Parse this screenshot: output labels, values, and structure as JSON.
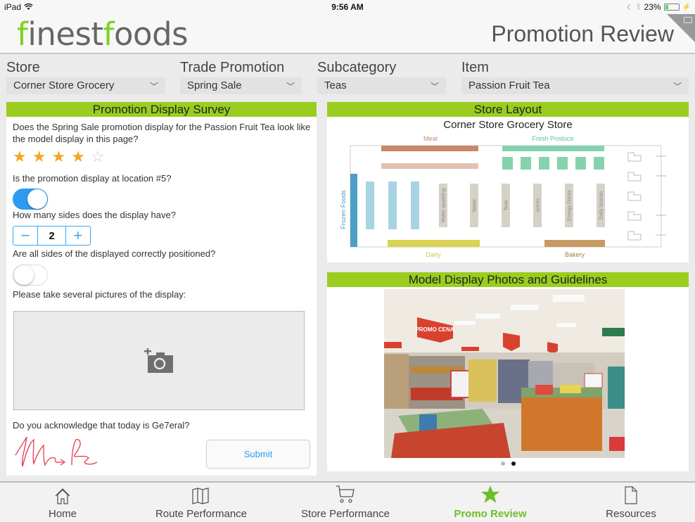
{
  "status_bar": {
    "device": "iPad",
    "time": "9:56 AM",
    "battery_percent": "23%",
    "battery_level": 0.23
  },
  "header": {
    "logo_part1": "finest",
    "logo_part2": "foods",
    "title": "Promotion Review"
  },
  "filters": [
    {
      "label": "Store",
      "value": "Corner Store Grocery"
    },
    {
      "label": "Trade Promotion",
      "value": "Spring Sale"
    },
    {
      "label": "Subcategory",
      "value": "Teas"
    },
    {
      "label": "Item",
      "value": "Passion Fruit Tea"
    }
  ],
  "survey": {
    "title": "Promotion Display Survey",
    "q1": "Does the Spring Sale promotion display for the Passion Fruit Tea look like the model display in this page?",
    "rating": 4,
    "rating_max": 5,
    "q2": "Is the promotion display at location #5?",
    "q2_answer": true,
    "q3": "How many sides does the display have?",
    "q3_value": "2",
    "q4": "Are all sides of the displayed correctly positioned?",
    "q4_answer": false,
    "q5": "Please take several pictures of the display:",
    "q6": "Do you acknowledge that today is Ge7eral?",
    "submit_label": "Submit"
  },
  "store_layout": {
    "title": "Store Layout",
    "store_name": "Corner Store Grocery Store",
    "sections": {
      "meat": "Meat",
      "fresh_produce": "Fresh Produce",
      "frozen_foods": "Frozen Foods",
      "dairy": "Dairy",
      "bakery": "Bakery"
    },
    "aisles": [
      "Water sparkling",
      "Water",
      "Teas",
      "Juices",
      "Energy Drinks",
      "Salty Snacks"
    ],
    "colors": {
      "meat": "#c9876a",
      "meat_light": "#e2c2b2",
      "produce": "#86d2ae",
      "frozen": "#4b9fc6",
      "frozen_light": "#a8d3e3",
      "aisle": "#d6d1c7",
      "dairy": "#d9d255",
      "bakery": "#c79a63"
    }
  },
  "model_display": {
    "title": "Model Display Photos and Guidelines",
    "photo_sign_text": "PROMO CENA",
    "page_count": 2,
    "current_page": 2
  },
  "tabbar": {
    "items": [
      {
        "label": "Home",
        "icon": "home-icon"
      },
      {
        "label": "Route Performance",
        "icon": "map-icon"
      },
      {
        "label": "Store Performance",
        "icon": "cart-icon"
      },
      {
        "label": "Promo Review",
        "icon": "star-icon",
        "active": true
      },
      {
        "label": "Resources",
        "icon": "document-icon"
      }
    ],
    "accent": "#6cbf2a"
  }
}
